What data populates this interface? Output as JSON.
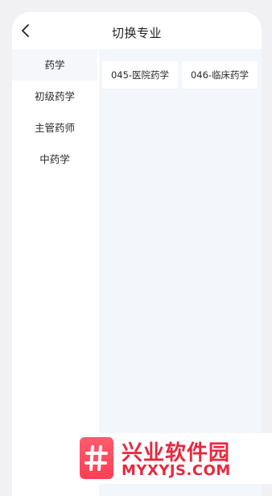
{
  "header": {
    "title": "切换专业",
    "back_icon": "chevron-left-icon"
  },
  "sidebar": {
    "items": [
      {
        "label": "药学",
        "active": true
      },
      {
        "label": "初级药学",
        "active": false
      },
      {
        "label": "主管药师",
        "active": false
      },
      {
        "label": "中药学",
        "active": false
      }
    ]
  },
  "main": {
    "specialties": [
      {
        "label": "045-医院药学"
      },
      {
        "label": "046-临床药学"
      }
    ]
  },
  "watermark": {
    "title": "兴业软件园",
    "domain": "MYXYJS.COM",
    "logo_icon": "hash-logo-icon"
  },
  "colors": {
    "background": "#f1f1f3",
    "panel": "#f3f6fb",
    "watermark_red": "#e8283f"
  }
}
